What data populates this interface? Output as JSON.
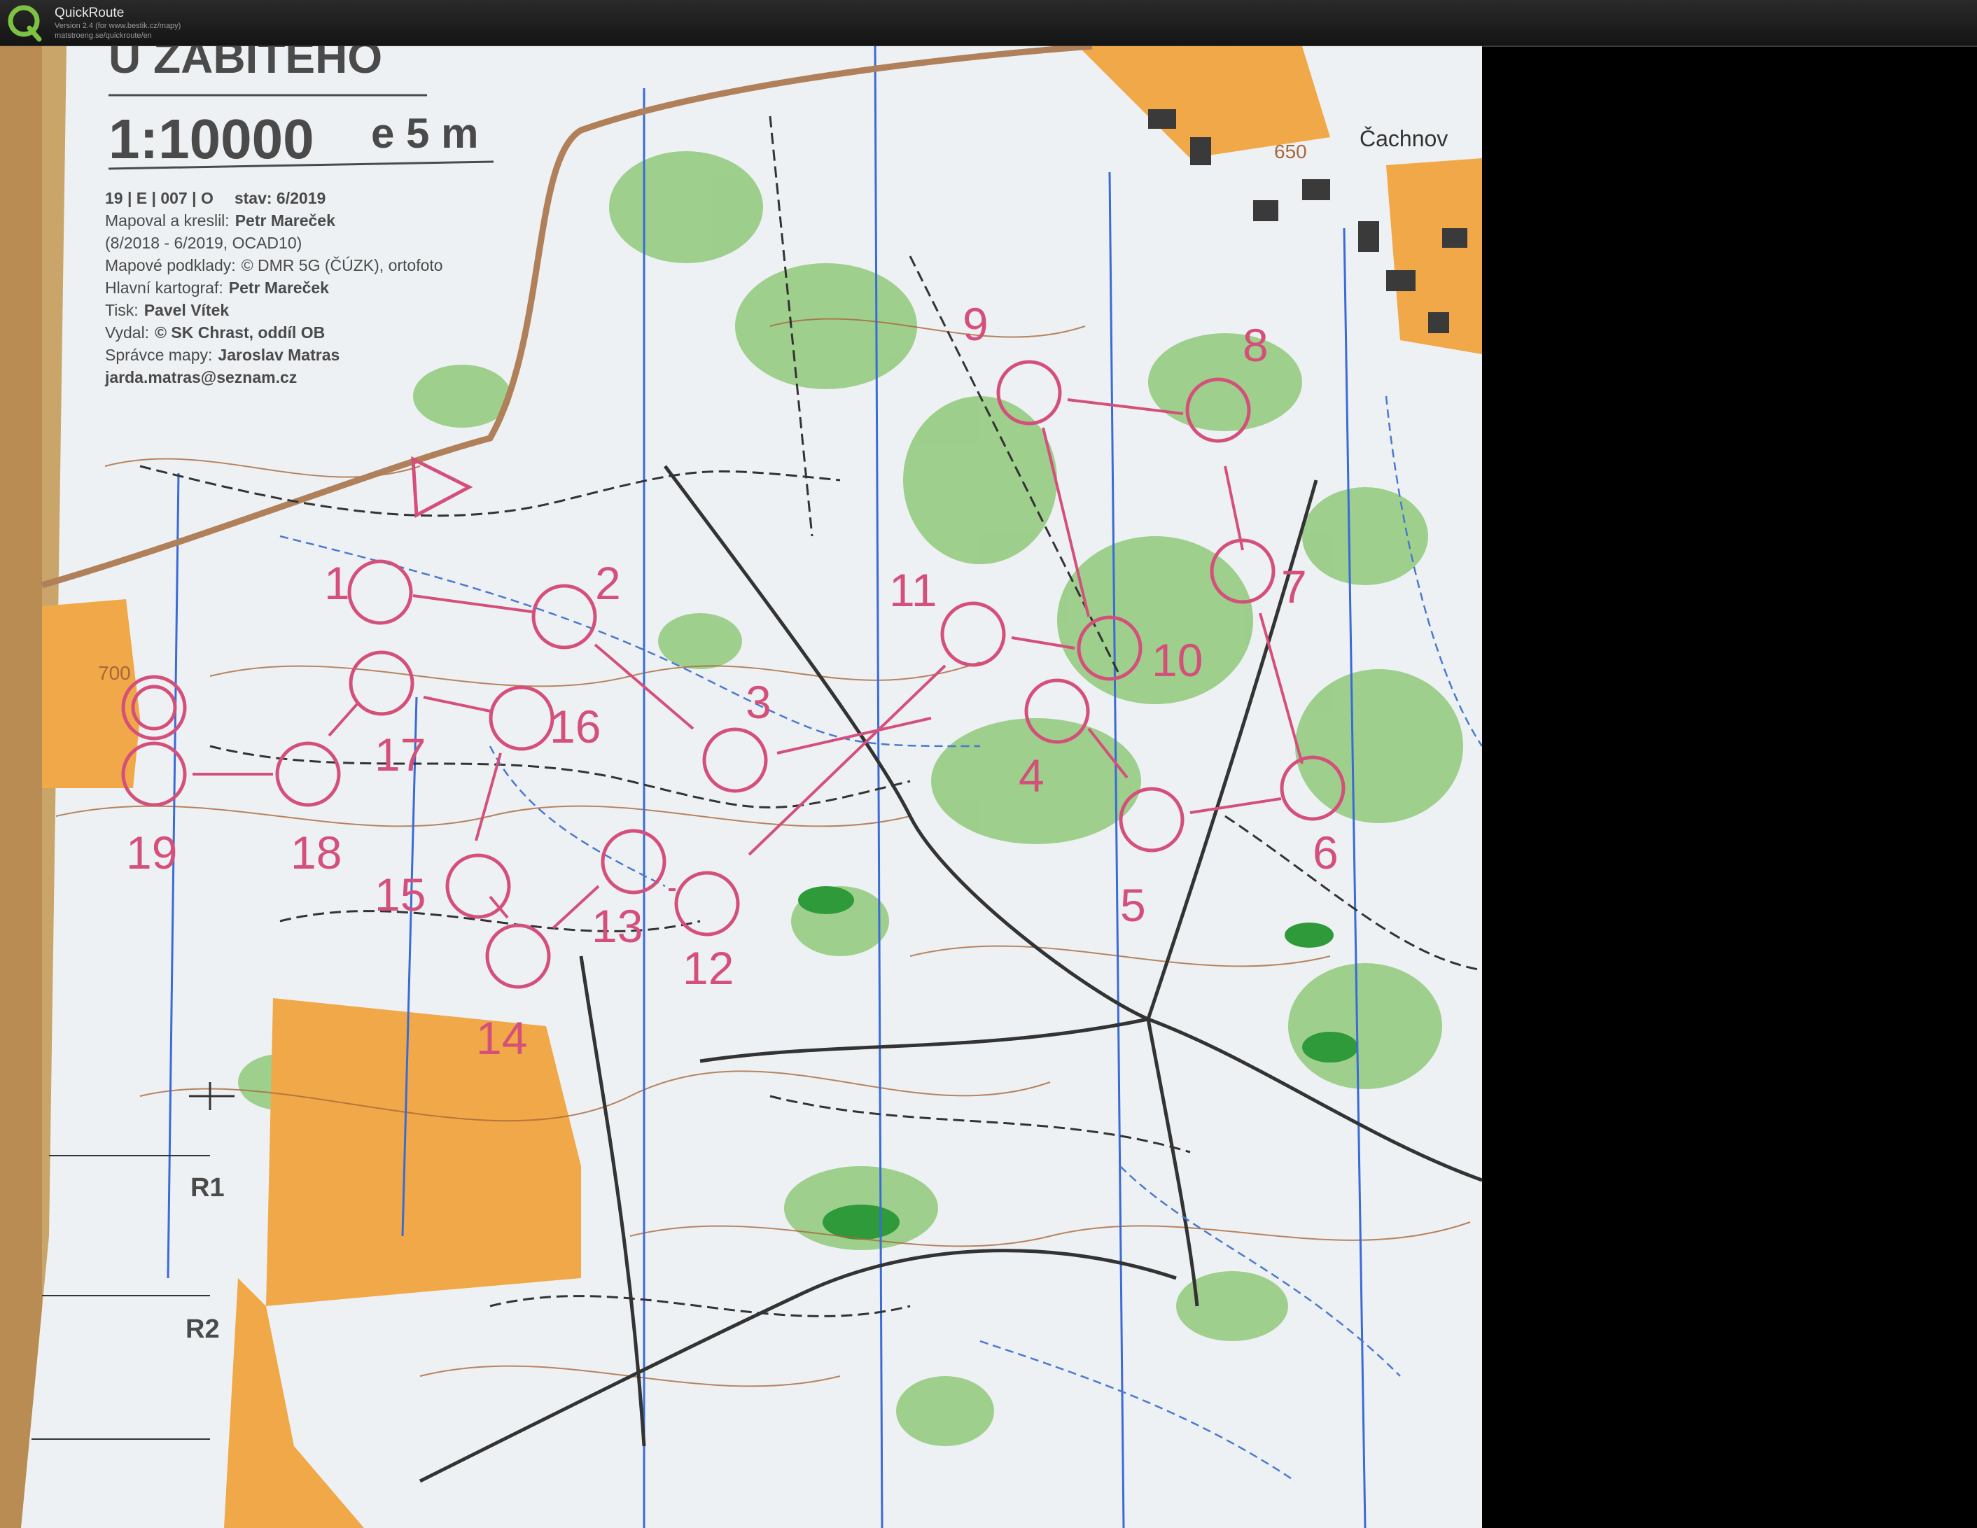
{
  "window": {
    "title": "QuickRoute",
    "version_line": "Version 2.4  (for www.bestik.cz/mapy)",
    "url_line": "matstroeng.se/quickroute/en"
  },
  "map": {
    "name": "U ZABITÉHO",
    "scale": "1:10000",
    "contour_interval": "e 5 m",
    "info_lines": [
      {
        "label": "19 | E | 007 | O",
        "value": "stav: 6/2019"
      },
      {
        "label": "Mapoval a kreslil:",
        "value": "Petr Mareček"
      },
      {
        "label": "(8/2018 - 6/2019, OCAD10)",
        "value": ""
      },
      {
        "label": "Mapové podklady:",
        "value": "© DMR 5G (ČÚZK), ortofoto"
      },
      {
        "label": "Hlavní kartograf:",
        "value": "Petr Mareček"
      },
      {
        "label": "Tisk:",
        "value": "Pavel Vítek"
      },
      {
        "label": "Vydal:",
        "value": "© SK Chrast, oddíl OB"
      },
      {
        "label": "Správce mapy:",
        "value": "Jaroslav Matras"
      },
      {
        "label": "jarda.matras@seznam.cz",
        "value": ""
      }
    ],
    "place_label": "Čachnov",
    "elevation_labels": [
      "650",
      "700"
    ],
    "relay_labels": [
      "R1",
      "R2"
    ],
    "controls": [
      "1",
      "2",
      "3",
      "4",
      "5",
      "6",
      "7",
      "8",
      "9",
      "10",
      "11",
      "12",
      "13",
      "14",
      "15",
      "16",
      "17",
      "18",
      "19"
    ],
    "colors": {
      "control": "#d4507a",
      "forest": "#8fc97a",
      "open_land": "#f0a848",
      "north_lines": "#3a6bd6",
      "paper": "#eef1f3"
    }
  }
}
